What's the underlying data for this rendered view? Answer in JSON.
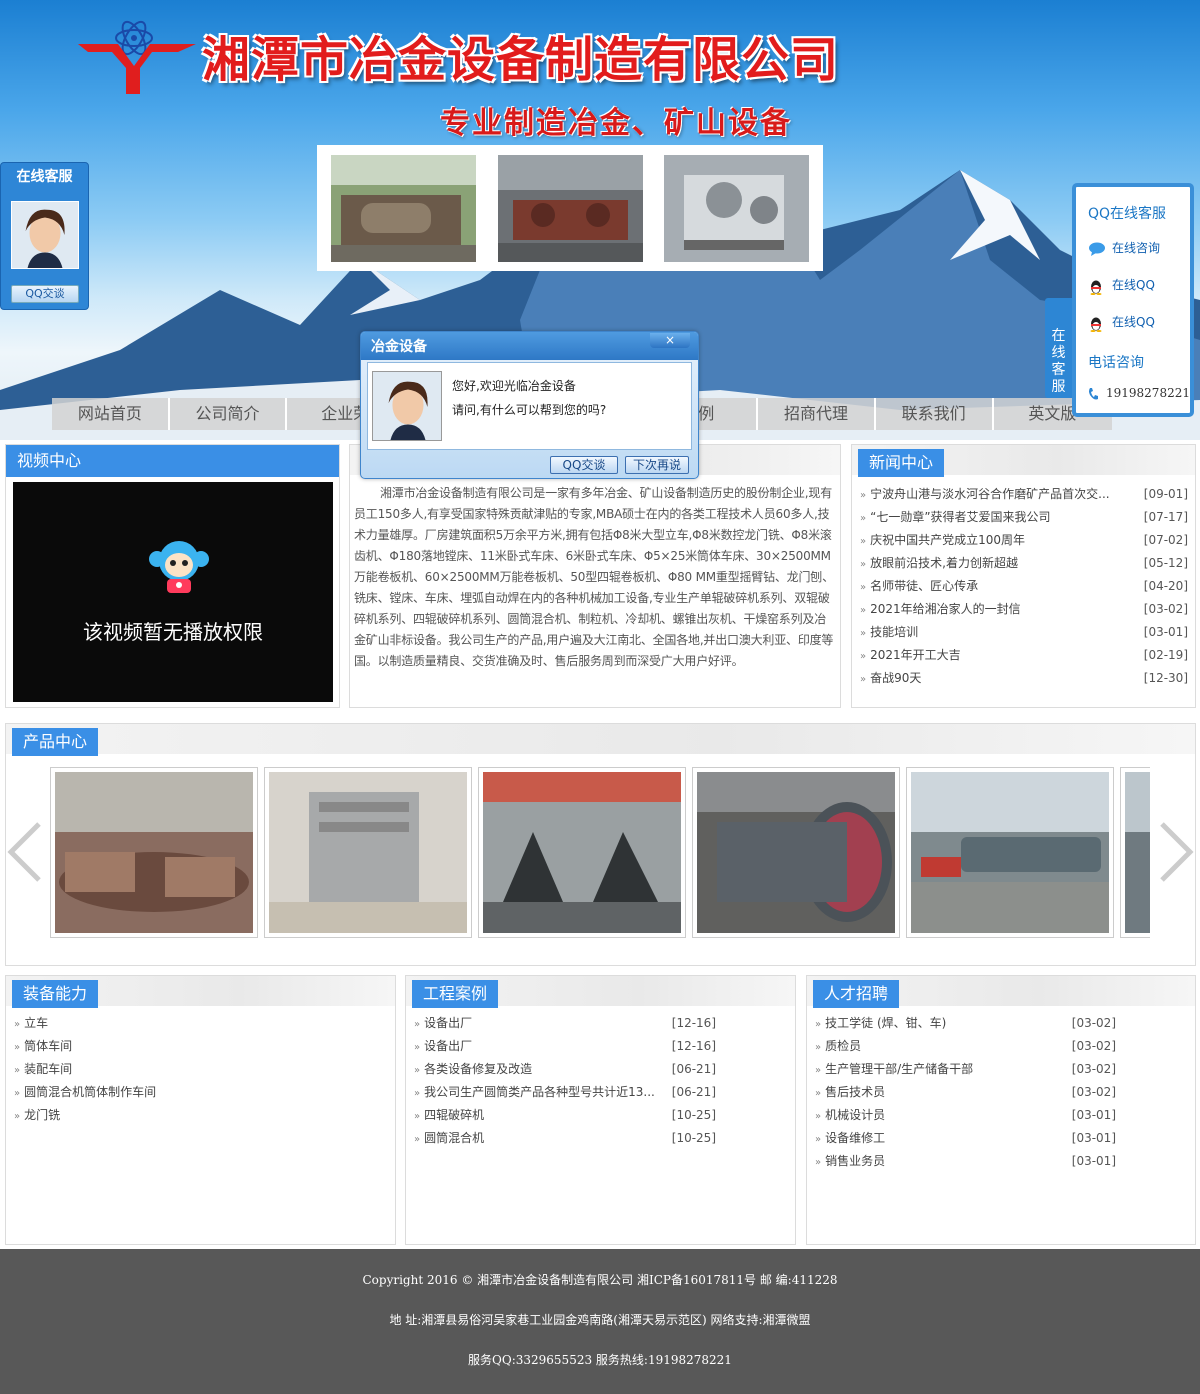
{
  "header": {
    "company_name": "湘潭市冶金设备制造有限公司",
    "slogan": "专业制造冶金、矿山设备"
  },
  "nav": {
    "items": [
      "网站首页",
      "公司简介",
      "企业荣",
      "",
      "",
      "案例",
      "招商代理",
      "联系我们",
      "英文版"
    ]
  },
  "left_service": {
    "title": "在线客服",
    "qq_button": "QQ交谈"
  },
  "right_qq": {
    "title": "QQ在线客服",
    "consult": "在线咨询",
    "qq1": "在线QQ",
    "qq2": "在线QQ",
    "phone_title": "电话咨询",
    "phone": "19198278221",
    "tab_text": "在线客服"
  },
  "popup": {
    "title": "冶金设备",
    "close": "×",
    "greeting": "您好,欢迎光临冶金设备",
    "question": "请问,有什么可以帮到您的吗?",
    "qq_button": "QQ交谈",
    "later_button": "下次再说"
  },
  "video": {
    "title": "视频中心",
    "no_permission": "该视频暂无播放权限"
  },
  "about": {
    "text": "湘潭市冶金设备制造有限公司是一家有多年冶金、矿山设备制造历史的股份制企业,现有员工150多人,有享受国家特殊贡献津贴的专家,MBA硕士在内的各类工程技术人员60多人,技术力量雄厚。厂房建筑面积5万余平方米,拥有包括Φ8米大型立车,Φ8米数控龙门铣、Φ8米滚齿机、Φ180落地镗床、11米卧式车床、6米卧式车床、Φ5×25米筒体车床、30×2500MM万能卷板机、60×2500MM万能卷板机、50型四辊卷板机、Φ80 MM重型摇臂钻、龙门刨、铣床、镗床、车床、埋弧自动焊在内的各种机械加工设备,专业生产单辊破碎机系列、双辊破碎机系列、四辊破碎机系列、圆筒混合机、制粒机、冷却机、螺锥出灰机、干燥窑系列及冶金矿山非标设备。我公司生产的产品,用户遍及大江南北、全国各地,并出口澳大利亚、印度等国。以制造质量精良、交货准确及时、售后服务周到而深受广大用户好评。"
  },
  "news": {
    "title": "新闻中心",
    "items": [
      {
        "t": "宁波舟山港与淡水河谷合作磨矿产品首次交...",
        "d": "[09-01]"
      },
      {
        "t": "“七一勋章”获得者艾爱国来我公司",
        "d": "[07-17]"
      },
      {
        "t": "庆祝中国共产党成立100周年",
        "d": "[07-02]"
      },
      {
        "t": "放眼前沿技术,着力创新超越",
        "d": "[05-12]"
      },
      {
        "t": "名师带徒、匠心传承",
        "d": "[04-20]"
      },
      {
        "t": "2021年给湘冶家人的一封信",
        "d": "[03-02]"
      },
      {
        "t": "技能培训",
        "d": "[03-01]"
      },
      {
        "t": "2021年开工大吉",
        "d": "[02-19]"
      },
      {
        "t": "奋战90天",
        "d": "[12-30]"
      }
    ]
  },
  "products": {
    "title": "产品中心",
    "prev": "‹",
    "next": "›"
  },
  "equipment": {
    "title": "装备能力",
    "items": [
      "立车",
      "筒体车间",
      "装配车间",
      "圆筒混合机筒体制作车间",
      "龙门铣"
    ]
  },
  "cases": {
    "title": "工程案例",
    "items": [
      {
        "t": "设备出厂",
        "d": "[12-16]"
      },
      {
        "t": "设备出厂",
        "d": "[12-16]"
      },
      {
        "t": "各类设备修复及改造",
        "d": "[06-21]"
      },
      {
        "t": "我公司生产圆筒类产品各种型号共计近13...",
        "d": "[06-21]"
      },
      {
        "t": "四辊破碎机",
        "d": "[10-25]"
      },
      {
        "t": "圆筒混合机",
        "d": "[10-25]"
      }
    ]
  },
  "jobs": {
    "title": "人才招聘",
    "items": [
      {
        "t": "技工学徒 (焊、钳、车)",
        "d": "[03-02]"
      },
      {
        "t": "质检员",
        "d": "[03-02]"
      },
      {
        "t": "生产管理干部/生产储备干部",
        "d": "[03-02]"
      },
      {
        "t": "售后技术员",
        "d": "[03-02]"
      },
      {
        "t": "机械设计员",
        "d": "[03-01]"
      },
      {
        "t": "设备维修工",
        "d": "[03-01]"
      },
      {
        "t": "销售业务员",
        "d": "[03-01]"
      }
    ]
  },
  "footer": {
    "line1": "Copyright 2016 © 湘潭市冶金设备制造有限公司 湘ICP备16017811号 邮 编:411228",
    "line2": "地 址:湘潭县易俗河吴家巷工业园金鸡南路(湘潭天易示范区) 网络支持:湘潭微盟",
    "line3": "服务QQ:3329655523 服务热线:19198278221"
  }
}
